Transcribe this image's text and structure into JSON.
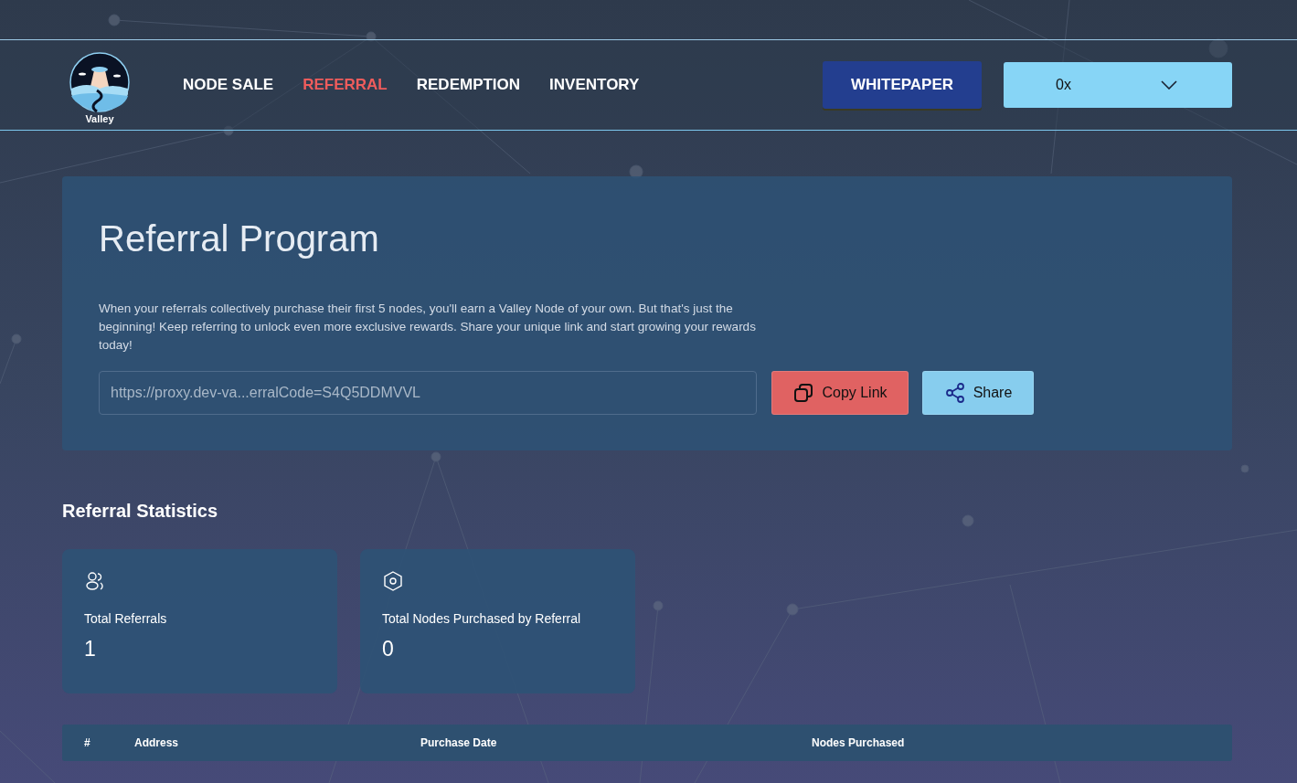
{
  "header": {
    "logo_text": "Valley",
    "nav": [
      {
        "label": "NODE SALE",
        "selected": false
      },
      {
        "label": "REFERRAL",
        "selected": true
      },
      {
        "label": "REDEMPTION",
        "selected": false
      },
      {
        "label": "INVENTORY",
        "selected": false
      }
    ],
    "whitepaper": "WHITEPAPER",
    "wallet": "0x"
  },
  "referral": {
    "title": "Referral Program",
    "description": "When your referrals collectively purchase their first 5 nodes, you'll earn a Valley Node of your own. But that's just the beginning! Keep referring to unlock even more exclusive rewards. Share your unique link and start growing your rewards today!",
    "link": "https://proxy.dev-va...erralCode=S4Q5DDMVVL",
    "copy_button": "Copy Link",
    "share_button": "Share"
  },
  "statistics": {
    "title": "Referral Statistics",
    "cards": [
      {
        "kind": "users",
        "label": "Total Referrals",
        "value": "1"
      },
      {
        "kind": "node",
        "label": "Total Nodes Purchased by Referral",
        "value": "0"
      }
    ]
  },
  "table": {
    "columns": [
      "#",
      "Address",
      "Purchase Date",
      "Nodes Purchased"
    ]
  }
}
